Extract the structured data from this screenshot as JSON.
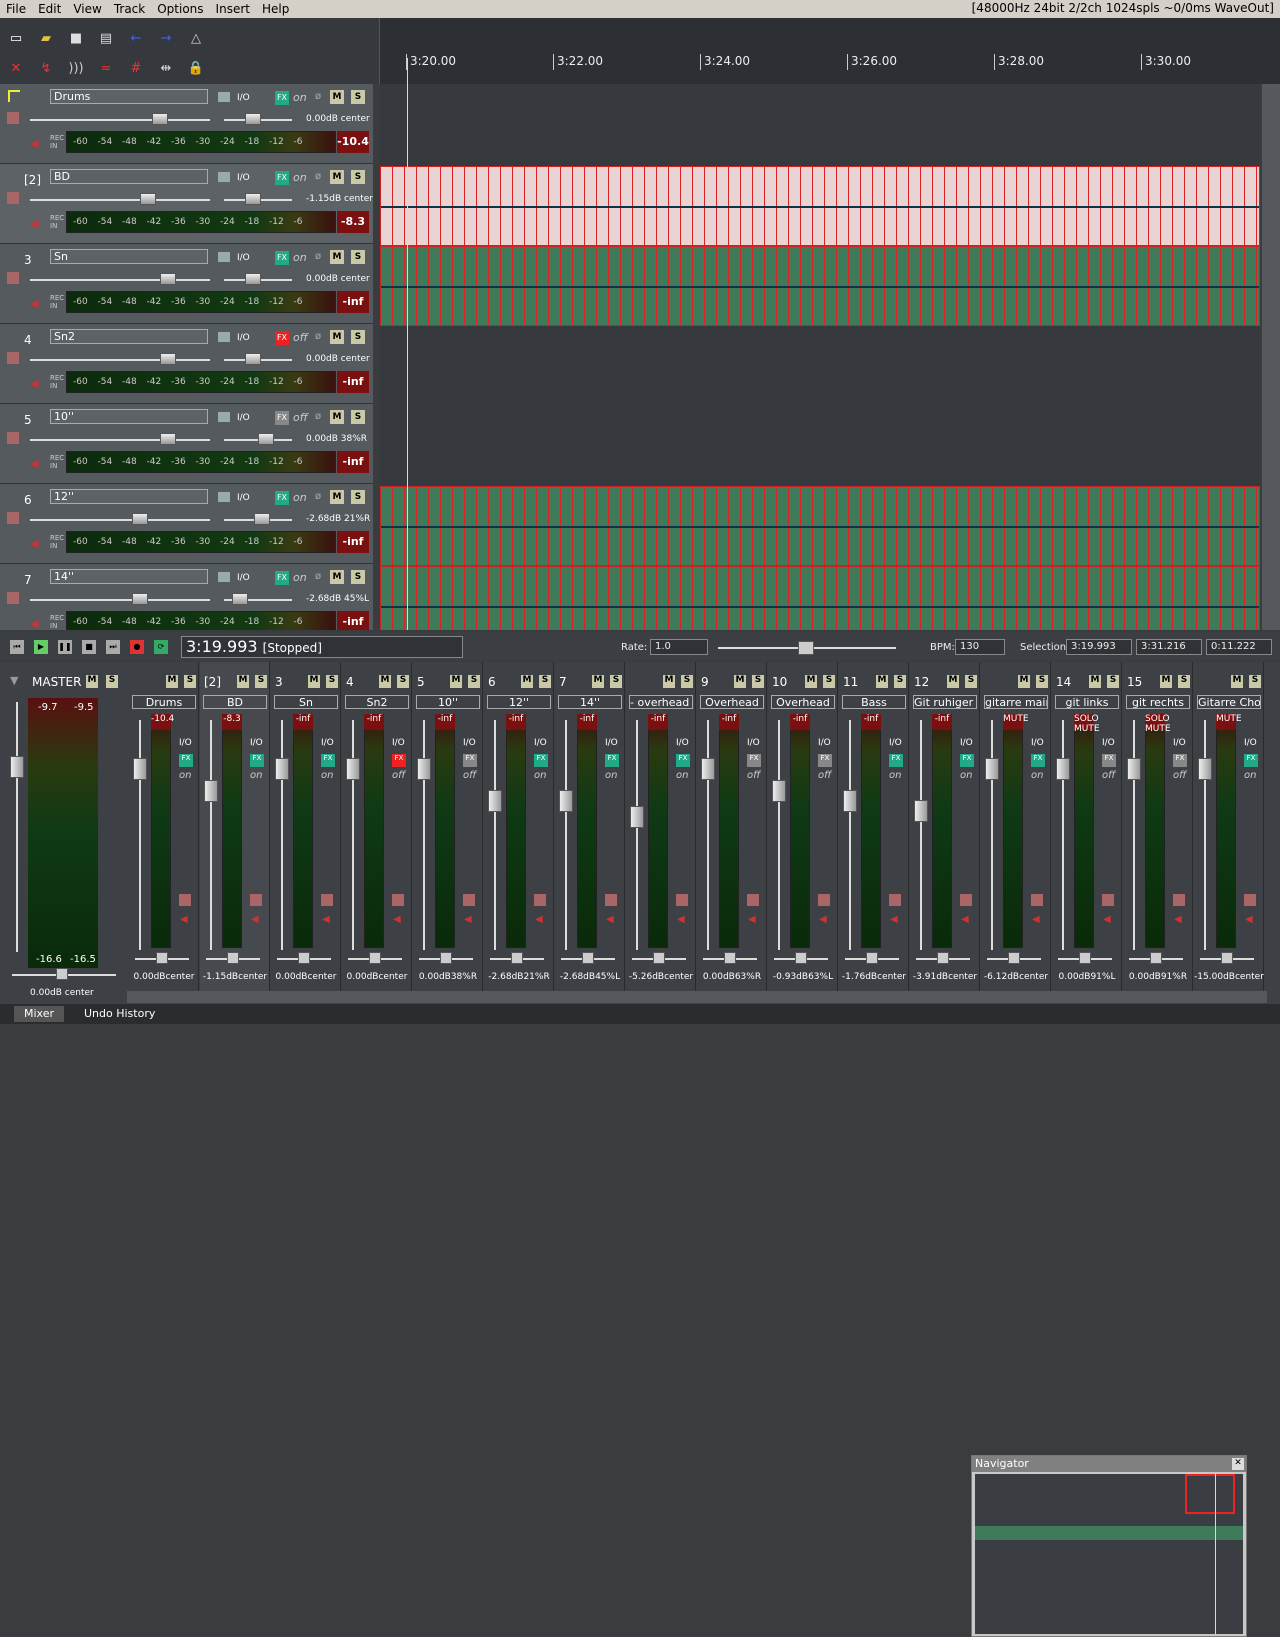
{
  "menu": [
    "File",
    "Edit",
    "View",
    "Track",
    "Options",
    "Insert",
    "Help"
  ],
  "status": "[48000Hz 24bit 2/2ch 1024spls ~0/0ms WaveOut]",
  "ruler": [
    "3:20.00",
    "3:22.00",
    "3:24.00",
    "3:26.00",
    "3:28.00",
    "3:30.00"
  ],
  "meter_scale": [
    "-60",
    "-54",
    "-48",
    "-42",
    "-36",
    "-30",
    "-24",
    "-18",
    "-12",
    "-6"
  ],
  "tracks": [
    {
      "num": "",
      "name": "Drums",
      "fx": "FX",
      "state": "on",
      "vol": "0.00dB center",
      "peak": "-10.4",
      "folder": true
    },
    {
      "num": "[2]",
      "name": "BD",
      "fx": "FX",
      "state": "on",
      "vol": "-1.15dB center",
      "peak": "-8.3"
    },
    {
      "num": "3",
      "name": "Sn",
      "fx": "FX",
      "state": "on",
      "vol": "0.00dB center",
      "peak": "-inf"
    },
    {
      "num": "4",
      "name": "Sn2",
      "fx": "FX",
      "state": "off",
      "vol": "0.00dB center",
      "peak": "-inf"
    },
    {
      "num": "5",
      "name": "10''",
      "fx": "FX",
      "state": "off",
      "vol": "0.00dB 38%R",
      "peak": "-inf"
    },
    {
      "num": "6",
      "name": "12''",
      "fx": "FX",
      "state": "on",
      "vol": "-2.68dB 21%R",
      "peak": "-inf"
    },
    {
      "num": "7",
      "name": "14''",
      "fx": "FX",
      "state": "on",
      "vol": "-2.68dB 45%L",
      "peak": "-inf"
    }
  ],
  "transport": {
    "time": "3:19.993",
    "status": "[Stopped]",
    "rate_label": "Rate:",
    "rate": "1.0",
    "bpm_label": "BPM:",
    "bpm": "130",
    "sel_label": "Selection:",
    "sel_start": "3:19.993",
    "sel_end": "3:31.216",
    "sel_len": "0:11.222"
  },
  "master": {
    "label": "MASTER",
    "peak_l": "-9.7",
    "peak_r": "-9.5",
    "min_l": "-16.6",
    "min_r": "-16.5",
    "vol": "0.00dB center"
  },
  "mixer": [
    {
      "num": "",
      "name": "Drums",
      "peak": "-10.4",
      "state": "on",
      "info": "0.00dBcenter"
    },
    {
      "num": "[2]",
      "name": "BD",
      "peak": "-8.3",
      "state": "on",
      "info": "-1.15dBcenter"
    },
    {
      "num": "3",
      "name": "Sn",
      "peak": "-inf",
      "state": "on",
      "info": "0.00dBcenter"
    },
    {
      "num": "4",
      "name": "Sn2",
      "peak": "-inf",
      "state": "off",
      "info": "0.00dBcenter"
    },
    {
      "num": "5",
      "name": "10''",
      "peak": "-inf",
      "state": "off",
      "info": "0.00dB38%R"
    },
    {
      "num": "6",
      "name": "12''",
      "peak": "-inf",
      "state": "on",
      "info": "-2.68dB21%R"
    },
    {
      "num": "7",
      "name": "14''",
      "peak": "-inf",
      "state": "on",
      "info": "-2.68dB45%L"
    },
    {
      "num": "",
      "name": "- overhead -",
      "peak": "-inf",
      "state": "on",
      "info": "-5.26dBcenter"
    },
    {
      "num": "9",
      "name": "Overhead",
      "peak": "-inf",
      "state": "off",
      "info": "0.00dB63%R"
    },
    {
      "num": "10",
      "name": "Overhead",
      "peak": "-inf",
      "state": "off",
      "info": "-0.93dB63%L"
    },
    {
      "num": "11",
      "name": "Bass",
      "peak": "-inf",
      "state": "on",
      "info": "-1.76dBcenter"
    },
    {
      "num": "12",
      "name": "Git ruhiger Te",
      "peak": "-inf",
      "state": "on",
      "info": "-3.91dBcenter"
    },
    {
      "num": "",
      "name": "gitarre main",
      "peak": "MUTE",
      "state": "on",
      "info": "-6.12dBcenter"
    },
    {
      "num": "14",
      "name": "git links",
      "peak": "SOLO MUTE",
      "state": "off",
      "info": "0.00dB91%L"
    },
    {
      "num": "15",
      "name": "git rechts",
      "peak": "SOLO MUTE",
      "state": "off",
      "info": "0.00dB91%R"
    },
    {
      "num": "",
      "name": "Gitarre Choru",
      "peak": "MUTE",
      "state": "on",
      "info": "-15.00dBcenter"
    }
  ],
  "navigator": {
    "title": "Navigator",
    "close": "✕"
  },
  "tabs": [
    "Mixer",
    "Undo History"
  ],
  "colors": {
    "item_green": "#3f7a5a",
    "item_red": "#e8d4d4",
    "cursor": "#eeee33"
  }
}
